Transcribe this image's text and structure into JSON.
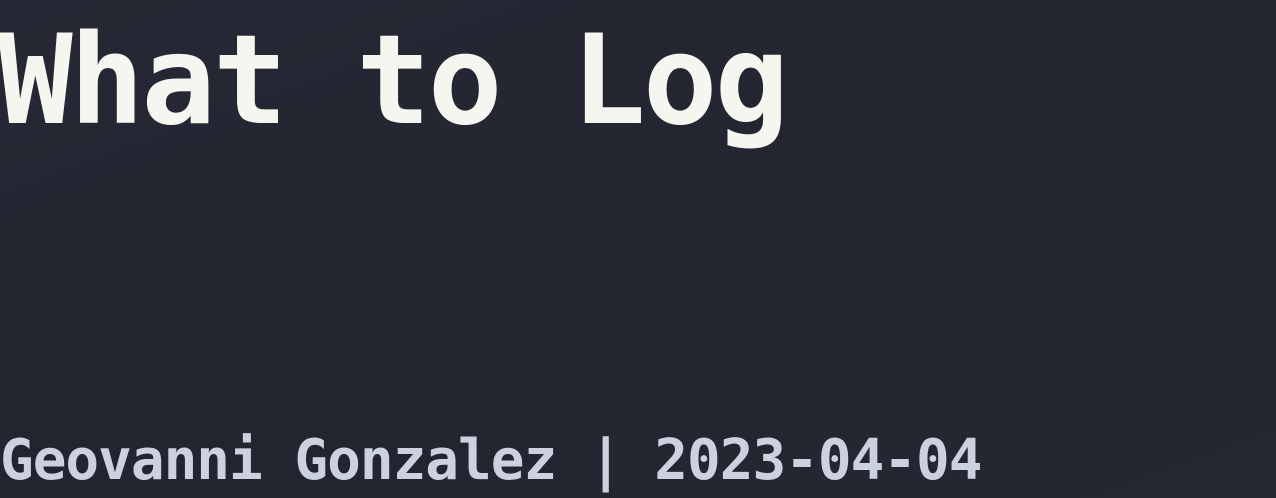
{
  "page": {
    "title": "What to Log",
    "byline": "Geovanni Gonzalez | 2023-04-04"
  },
  "colors": {
    "background": "#242631",
    "title": "#f5f6f0",
    "byline": "#cbd2de"
  }
}
